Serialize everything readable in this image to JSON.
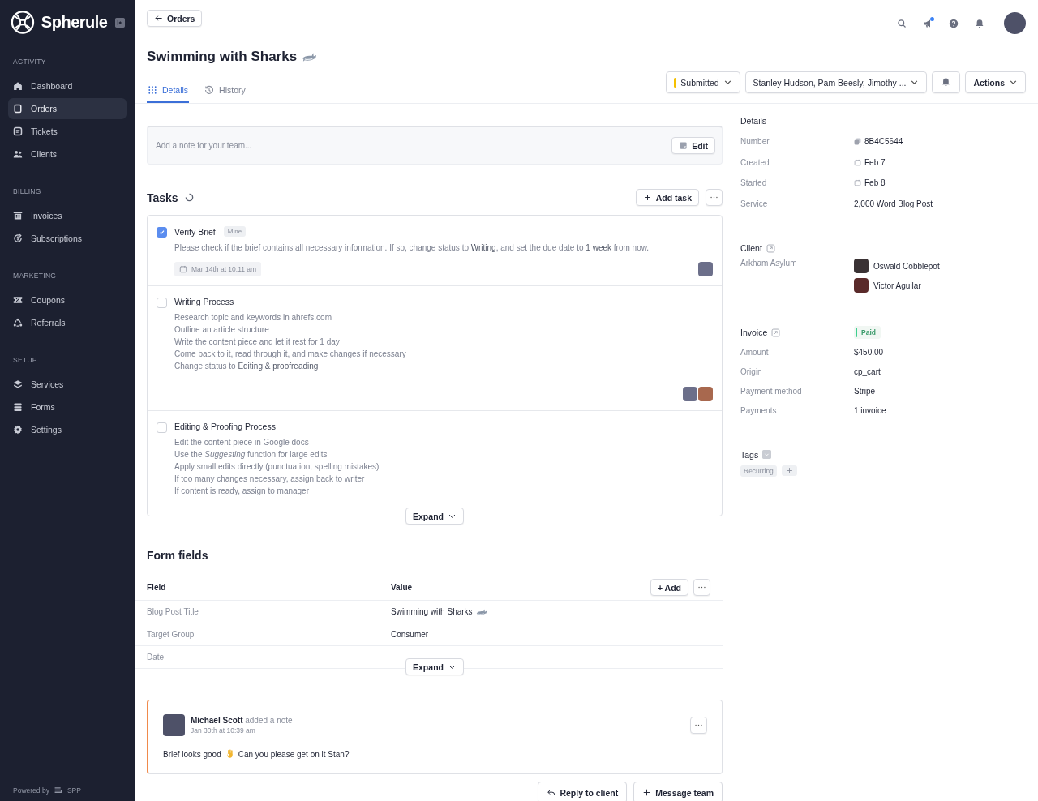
{
  "sidebar": {
    "brand": "Spherule",
    "sections": [
      {
        "title": "ACTIVITY",
        "items": [
          {
            "label": "Dashboard",
            "selected": false
          },
          {
            "label": "Orders",
            "selected": true
          },
          {
            "label": "Tickets",
            "selected": false
          },
          {
            "label": "Clients",
            "selected": false
          }
        ]
      },
      {
        "title": "BILLING",
        "items": [
          {
            "label": "Invoices",
            "selected": false
          },
          {
            "label": "Subscriptions",
            "selected": false
          }
        ]
      },
      {
        "title": "MARKETING",
        "items": [
          {
            "label": "Coupons",
            "selected": false
          },
          {
            "label": "Referrals",
            "selected": false
          }
        ]
      },
      {
        "title": "SETUP",
        "items": [
          {
            "label": "Services",
            "selected": false
          },
          {
            "label": "Forms",
            "selected": false
          },
          {
            "label": "Settings",
            "selected": false
          }
        ]
      }
    ],
    "powered_by": "Powered by",
    "powered_brand": "SPP"
  },
  "header": {
    "back": "Orders",
    "title": "Swimming with Sharks"
  },
  "tabs": [
    {
      "label": "Details",
      "selected": true
    },
    {
      "label": "History",
      "selected": false
    }
  ],
  "controls": {
    "status": {
      "label": "Submitted",
      "color": "#f5c000"
    },
    "assignees": "Stanley Hudson, Pam Beesly, Jimothy ...",
    "actions": "Actions"
  },
  "note_field": {
    "placeholder": "Add a note for your team...",
    "edit": "Edit"
  },
  "tasks": {
    "title": "Tasks",
    "add": "Add task",
    "expand": "Expand",
    "items": [
      {
        "title": "Verify Brief",
        "checked": true,
        "badge": "Mine",
        "lines": [
          "Please check if the brief contains all necessary information. If so, change status to **Writing**, and set the due date to **1 week** from now."
        ],
        "due": "Mar 14th at 10:11 am"
      },
      {
        "title": "Writing Process",
        "checked": false,
        "lines": [
          "Research topic and keywords in ahrefs.com",
          "Outline an article structure",
          "Write the content piece and let it rest for 1 day",
          "Come back to it, read through it, and make changes if necessary",
          "Change status to **Editing & proofreading**"
        ]
      },
      {
        "title": "Editing & Proofing Process",
        "checked": false,
        "lines": [
          "Edit the content piece in Google docs",
          "Use the *Suggesting* function for large edits",
          "Apply small edits directly (punctuation, spelling mistakes)",
          "If too many changes necessary, assign back to writer",
          "If content is ready, assign to manager"
        ]
      }
    ]
  },
  "form_fields": {
    "title": "Form fields",
    "columns": [
      "Field",
      "Value"
    ],
    "add": "+ Add",
    "expand": "Expand",
    "rows": [
      {
        "field": "Blog Post Title",
        "value": "Swimming with Sharks"
      },
      {
        "field": "Target Group",
        "value": "Consumer"
      },
      {
        "field": "Date",
        "value": "--"
      }
    ]
  },
  "note": {
    "author": "Michael Scott",
    "action": "added a note",
    "time": "Jan 30th at 10:39 am",
    "text_before": "Brief looks good",
    "text_after": "Can you please get on it Stan?"
  },
  "footer_buttons": [
    {
      "label": "Reply to client"
    },
    {
      "label": "Message team"
    }
  ],
  "details": {
    "title": "Details",
    "rows": [
      {
        "label": "Number",
        "value": "8B4C5644"
      },
      {
        "label": "Created",
        "value": "Feb 7"
      },
      {
        "label": "Started",
        "value": "Feb 8"
      },
      {
        "label": "Service",
        "value": "2,000 Word Blog Post"
      }
    ]
  },
  "client": {
    "title": "Client",
    "name": "Arkham Asylum",
    "contacts": [
      "Oswald Cobblepot",
      "Victor Aguilar"
    ]
  },
  "invoice": {
    "title": "Invoice",
    "status": {
      "label": "Paid",
      "color": "#3ecf8e"
    },
    "rows": [
      {
        "label": "Amount",
        "value": "$450.00"
      },
      {
        "label": "Origin",
        "value": "cp_cart"
      },
      {
        "label": "Payment method",
        "value": "Stripe"
      },
      {
        "label": "Payments",
        "value": "1 invoice"
      }
    ]
  },
  "tags": {
    "title": "Tags",
    "items": [
      "Recurring"
    ]
  }
}
